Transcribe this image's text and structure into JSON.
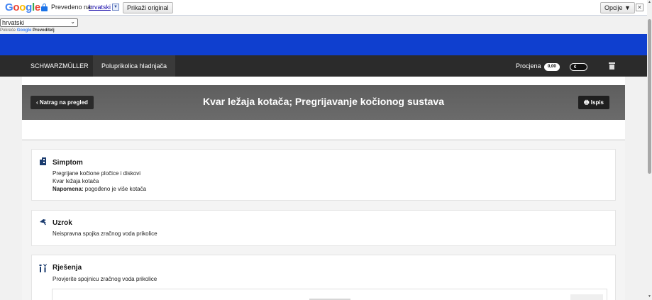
{
  "translate_bar": {
    "logo": [
      "G",
      "o",
      "o",
      "g",
      "l",
      "e"
    ],
    "translated_to": "Prevedeno na:",
    "language_link": "hrvatski",
    "dropdown_glyph": "▼",
    "show_original": "Prikaži original",
    "options": "Opcije ▼",
    "close": "✕"
  },
  "language_select": {
    "value": "hrvatski",
    "chevron": "⌄"
  },
  "powered_by": {
    "prefix": "Pokreće",
    "google": "Google",
    "product": "Prevoditelj"
  },
  "nav": {
    "brand": "SCHWARZMÜLLER",
    "vehicle": "Poluprikolica hladnjača",
    "estimate_label": "Procjena",
    "estimate_value": "0,00",
    "currency": "€"
  },
  "header": {
    "back_label": "‹  Natrag na pregled",
    "title": "Kvar ležaja kotača; Pregrijavanje kočionog sustava",
    "print_label": "🖶  Ispis"
  },
  "cards": {
    "symptom": {
      "title": "Simptom",
      "lines": [
        "Pregrijane kočione pločice i diskovi",
        "Kvar ležaja kotača"
      ],
      "note_label": "Napomena:",
      "note_text": " pogođeno je više kotača"
    },
    "cause": {
      "title": "Uzrok",
      "line": "Neispravna spojka zračnog voda prikolice"
    },
    "solution": {
      "title": "Rješenja",
      "line": "Provjerite spojnicu zračnog voda prikolice"
    }
  },
  "icons": {
    "symptom": "building-icon",
    "cause": "flag-icon",
    "solution": "tools-icon"
  },
  "colors": {
    "blue_band": "#0f3fcf",
    "nav_bg": "#2b2b2b",
    "header_bg": "#636363",
    "icon": "#1a3b6e"
  }
}
